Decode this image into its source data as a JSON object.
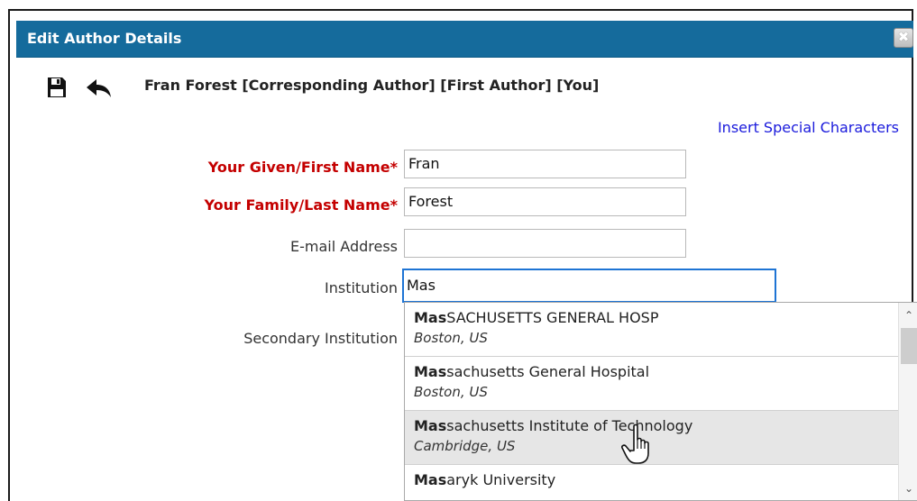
{
  "dialog": {
    "title": "Edit Author Details",
    "close_glyph": "✖"
  },
  "toolbar": {
    "save_icon": "floppy-disk-icon",
    "back_icon": "back-arrow-icon"
  },
  "author_heading": "Fran Forest [Corresponding Author] [First Author] [You]",
  "special_characters_link": "Insert Special Characters",
  "form": {
    "given_name": {
      "label": "Your Given/First Name*",
      "value": "Fran"
    },
    "family_name": {
      "label": "Your Family/Last Name*",
      "value": "Forest"
    },
    "email": {
      "label": "E-mail Address",
      "value": ""
    },
    "institution": {
      "label": "Institution",
      "value": "Mas"
    },
    "secondary_institution": {
      "label": "Secondary Institution"
    }
  },
  "autocomplete": {
    "query_match": "Mas",
    "items": [
      {
        "match": "Mas",
        "rest": "SACHUSETTS GENERAL HOSP",
        "place": "Boston, US"
      },
      {
        "match": "Mas",
        "rest": "sachusetts General Hospital",
        "place": "Boston, US"
      },
      {
        "match": "Mas",
        "rest": "sachusetts Institute of Technology",
        "place": "Cambridge, US"
      },
      {
        "match": "Mas",
        "rest": "aryk University",
        "place": ""
      }
    ],
    "scroll_up": "⌃",
    "scroll_down": "⌄"
  },
  "colors": {
    "title_bar": "#156b9c",
    "required_label": "#c40000",
    "link": "#1a1adc",
    "focus_border": "#1e74d4"
  }
}
